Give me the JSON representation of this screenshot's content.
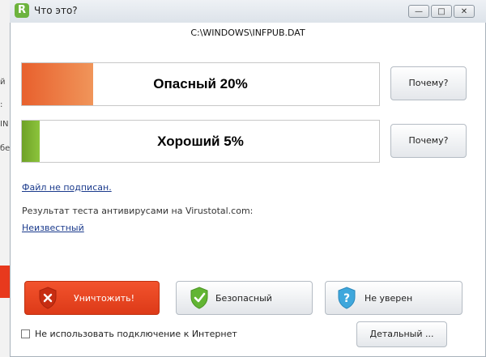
{
  "window": {
    "title": "Что это?",
    "file_path": "C:\\WINDOWS\\INFPUB.DAT"
  },
  "ratings": [
    {
      "label": "Опасный 20%",
      "percent": 20,
      "color": "#e8602d",
      "why_label": "Почему?"
    },
    {
      "label": "Хороший 5%",
      "percent": 5,
      "color": "#7cb031",
      "why_label": "Почему?"
    }
  ],
  "signature_link": "Файл не подписан.",
  "virustotal": {
    "label": "Результат теста антивирусами на Virustotal.com:",
    "result_link": "Неизвестный"
  },
  "actions": {
    "destroy": {
      "label": "Уничтожить!",
      "icon": "shield-x-icon",
      "color": "#e8391d"
    },
    "safe": {
      "label": "Безопасный",
      "icon": "shield-check-icon",
      "color": "#62b533"
    },
    "unsure": {
      "label": "Не уверен",
      "icon": "shield-question-icon",
      "color": "#3fa7dc"
    }
  },
  "footer": {
    "checkbox_label": "Не использовать подключение к Интернет",
    "details_label": "Детальный ..."
  },
  "background_fragments": [
    "й",
    ":",
    "IN",
    "бе"
  ]
}
